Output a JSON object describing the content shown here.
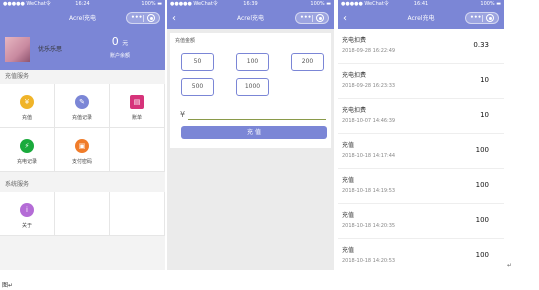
{
  "status": {
    "signal": "●●●●● WeChat令",
    "battery": "100%  ▬",
    "times": [
      "16:24",
      "16:39",
      "16:41"
    ]
  },
  "p1": {
    "title": "Acrel充电",
    "username": "优乐乐思",
    "balance_value": "0",
    "balance_unit": "元",
    "balance_label": "账户余额",
    "section1": "充值服务",
    "section2": "系统服务",
    "items": [
      {
        "label": "充值",
        "color": "#f0b429",
        "icon": "¥"
      },
      {
        "label": "充值记录",
        "color": "#7b86d6",
        "icon": "✎"
      },
      {
        "label": "账单",
        "color": "#d6337a",
        "icon": "▤"
      },
      {
        "label": "充电记录",
        "color": "#1aaa3c",
        "icon": "⚡"
      },
      {
        "label": "支付密码",
        "color": "#f07c2a",
        "icon": "🔒"
      },
      {
        "label": "关于",
        "color": "#b46cd6",
        "icon": "i"
      }
    ]
  },
  "p2": {
    "title": "Acrel充电",
    "header": "充值金额",
    "amounts": [
      "50",
      "100",
      "200",
      "500",
      "1000"
    ],
    "currency": "¥",
    "button": "充 值"
  },
  "p3": {
    "title": "Acrel充电",
    "records": [
      {
        "type": "充电扣费",
        "date": "2018-09-28 16:22:49",
        "amount": "0.33"
      },
      {
        "type": "充电扣费",
        "date": "2018-09-28 16:23:33",
        "amount": "10"
      },
      {
        "type": "充电扣费",
        "date": "2018-10-07 14:46:39",
        "amount": "10"
      },
      {
        "type": "充值",
        "date": "2018-10-18 14:17:44",
        "amount": "100"
      },
      {
        "type": "充值",
        "date": "2018-10-18 14:19:53",
        "amount": "100"
      },
      {
        "type": "充值",
        "date": "2018-10-18 14:20:35",
        "amount": "100"
      },
      {
        "type": "充值",
        "date": "2018-10-18 14:20:53",
        "amount": "100"
      }
    ]
  },
  "footer": {
    "caption": "图↵",
    "return_mark": "↵"
  }
}
